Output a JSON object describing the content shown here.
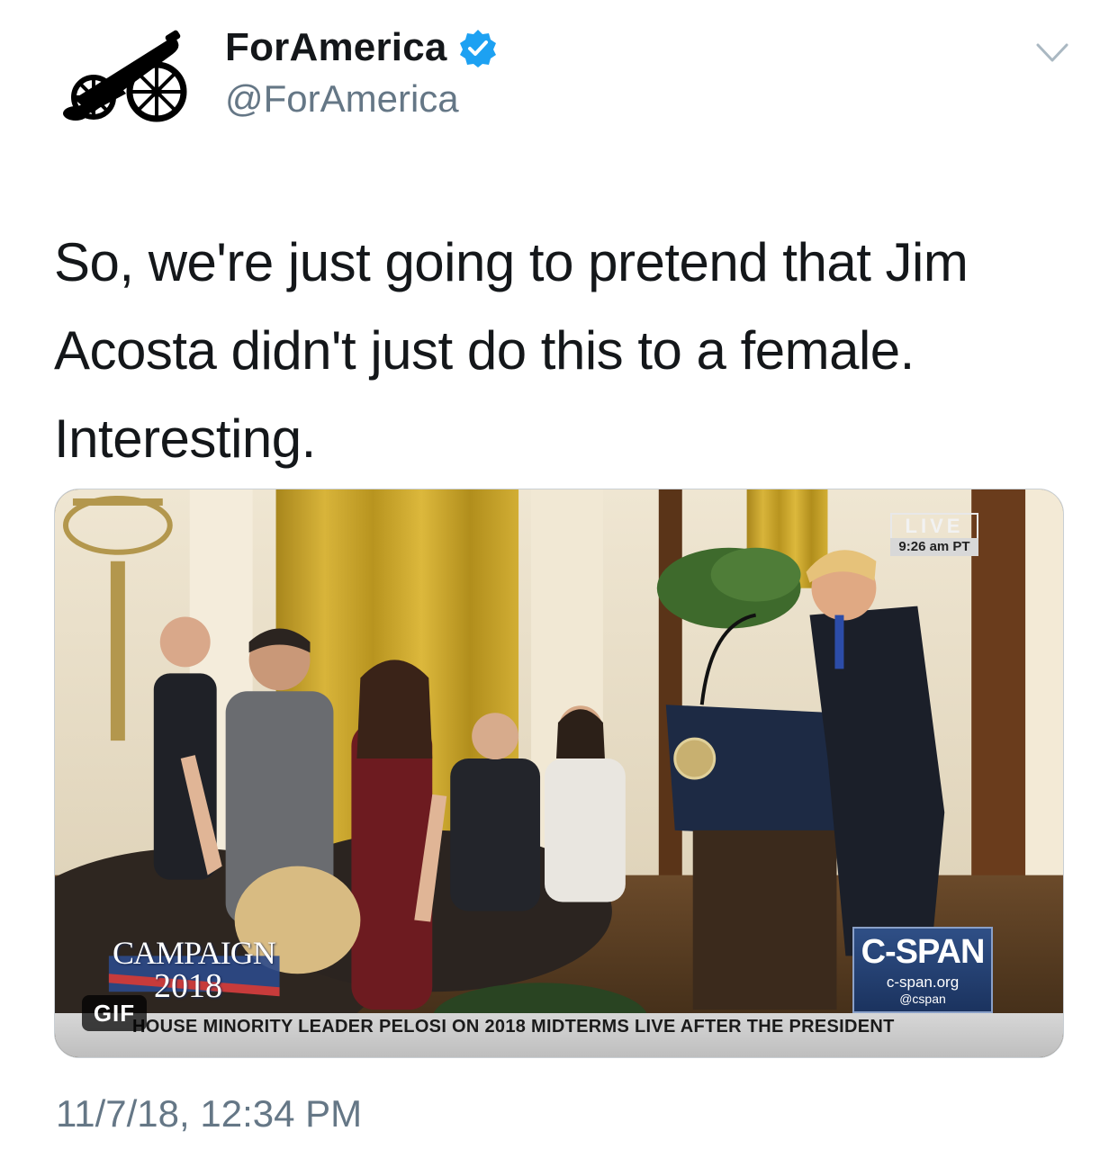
{
  "tweet": {
    "display_name": "ForAmerica",
    "handle": "@ForAmerica",
    "verified": true,
    "avatar_icon": "cannon-icon",
    "menu_icon": "chevron-down-icon",
    "text_lines": [
      "So, we're just going to pretend that Jim",
      "Acosta didn't just do this to a female.",
      "Interesting."
    ],
    "timestamp": "11/7/18, 12:34 PM"
  },
  "media": {
    "type": "gif",
    "badge": "GIF",
    "live_label": "LIVE",
    "live_time": "9:26 am PT",
    "campaign_word": "CAMPAIGN",
    "campaign_year": "2018",
    "cspan_name": "C-SPAN",
    "cspan_url": "c-span.org",
    "cspan_handle": "@cspan",
    "ticker": "HOUSE MINORITY LEADER PELOSI ON 2018 MIDTERMS LIVE AFTER THE PRESIDENT"
  },
  "colors": {
    "verified_blue": "#1da1f2",
    "secondary_text": "#657786",
    "primary_text": "#14171a"
  }
}
